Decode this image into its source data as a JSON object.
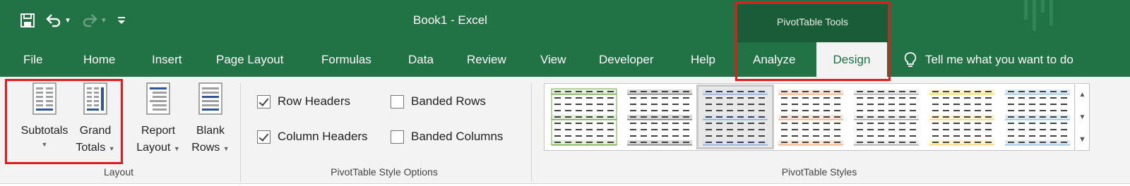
{
  "window": {
    "title": "Book1  -  Excel",
    "context_group": "PivotTable Tools",
    "accent": "#217346"
  },
  "qat": {
    "save_icon": "save-icon",
    "undo_icon": "undo-icon",
    "redo_icon": "redo-icon",
    "customize_icon": "customize-qat-icon"
  },
  "tabs": [
    {
      "label": "File"
    },
    {
      "label": "Home"
    },
    {
      "label": "Insert"
    },
    {
      "label": "Page Layout"
    },
    {
      "label": "Formulas"
    },
    {
      "label": "Data"
    },
    {
      "label": "Review"
    },
    {
      "label": "View"
    },
    {
      "label": "Developer"
    },
    {
      "label": "Help"
    },
    {
      "label": "Analyze"
    },
    {
      "label": "Design",
      "active": true
    }
  ],
  "tell_me": {
    "icon": "lightbulb-icon",
    "text": "Tell me what you want to do"
  },
  "groups": {
    "layout": {
      "label": "Layout",
      "buttons": [
        {
          "line1": "Subtotals",
          "line2": "",
          "icon": "subtotals-icon"
        },
        {
          "line1": "Grand",
          "line2": "Totals",
          "icon": "grand-totals-icon"
        },
        {
          "line1": "Report",
          "line2": "Layout",
          "icon": "report-layout-icon"
        },
        {
          "line1": "Blank",
          "line2": "Rows",
          "icon": "blank-rows-icon"
        }
      ]
    },
    "style_options": {
      "label": "PivotTable Style Options",
      "row_headers": {
        "label": "Row Headers",
        "checked": true
      },
      "column_headers": {
        "label": "Column Headers",
        "checked": true
      },
      "banded_rows": {
        "label": "Banded Rows",
        "checked": false
      },
      "banded_columns": {
        "label": "Banded Columns",
        "checked": false
      }
    },
    "styles": {
      "label": "PivotTable Styles",
      "tiles": [
        {
          "color": "#70ad47",
          "band": "#e2efda"
        },
        {
          "color": "#7f7f7f",
          "band": "#d9d9d9"
        },
        {
          "color": "#8ea9db",
          "band": "#d9e1f2"
        },
        {
          "color": "#f4b084",
          "band": "#fce4d6"
        },
        {
          "color": "#a5a5a5",
          "band": "#ededed"
        },
        {
          "color": "#ffd966",
          "band": "#fff2cc"
        },
        {
          "color": "#9bc2e6",
          "band": "#ddebf7"
        }
      ]
    }
  },
  "highlight_color": "#e21a1a"
}
